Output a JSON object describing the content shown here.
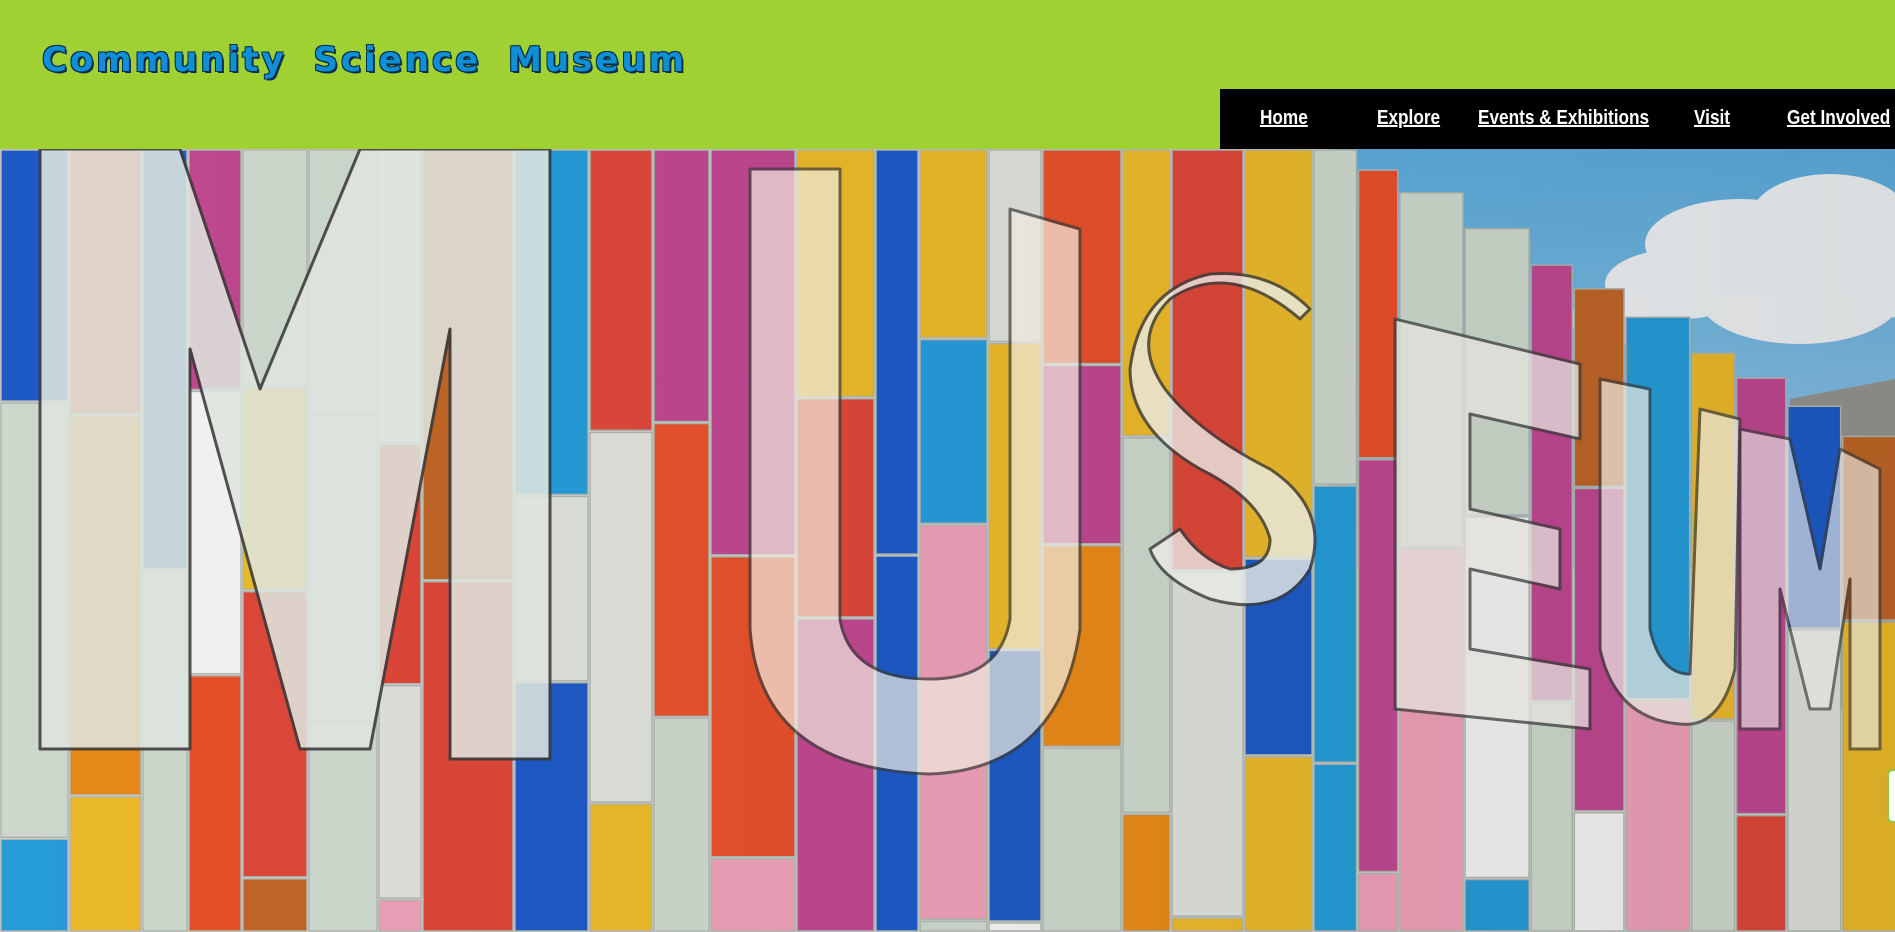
{
  "site": {
    "title": "Community Science Museum"
  },
  "nav": {
    "items": [
      {
        "label": "Home"
      },
      {
        "label": "Explore"
      },
      {
        "label": "Events & Exhibitions"
      },
      {
        "label": "Visit"
      },
      {
        "label": "Get Involved"
      }
    ]
  },
  "hero": {
    "image_description_icon": "museum-facade-image",
    "lettering": "MUSEUM"
  },
  "colors": {
    "header_bg": "#9fd133",
    "nav_bg": "#000000",
    "nav_text": "#ffffff",
    "title_color": "#0e8fd6",
    "title_outline": "#0a2d4d"
  }
}
